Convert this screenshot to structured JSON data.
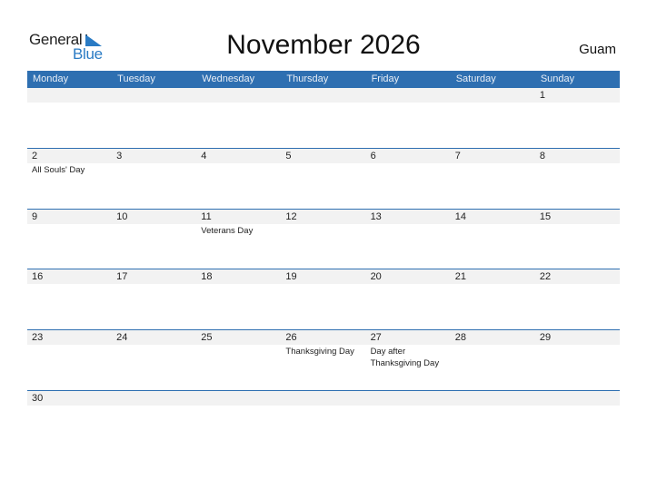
{
  "logo": {
    "general": "General",
    "blue": "Blue"
  },
  "title": "November 2026",
  "region": "Guam",
  "weekdays": [
    "Monday",
    "Tuesday",
    "Wednesday",
    "Thursday",
    "Friday",
    "Saturday",
    "Sunday"
  ],
  "weeks": [
    [
      {
        "d": ""
      },
      {
        "d": ""
      },
      {
        "d": ""
      },
      {
        "d": ""
      },
      {
        "d": ""
      },
      {
        "d": ""
      },
      {
        "d": "1"
      }
    ],
    [
      {
        "d": "2",
        "h": "All Souls' Day"
      },
      {
        "d": "3"
      },
      {
        "d": "4"
      },
      {
        "d": "5"
      },
      {
        "d": "6"
      },
      {
        "d": "7"
      },
      {
        "d": "8"
      }
    ],
    [
      {
        "d": "9"
      },
      {
        "d": "10"
      },
      {
        "d": "11",
        "h": "Veterans Day"
      },
      {
        "d": "12"
      },
      {
        "d": "13"
      },
      {
        "d": "14"
      },
      {
        "d": "15"
      }
    ],
    [
      {
        "d": "16"
      },
      {
        "d": "17"
      },
      {
        "d": "18"
      },
      {
        "d": "19"
      },
      {
        "d": "20"
      },
      {
        "d": "21"
      },
      {
        "d": "22"
      }
    ],
    [
      {
        "d": "23"
      },
      {
        "d": "24"
      },
      {
        "d": "25"
      },
      {
        "d": "26",
        "h": "Thanksgiving Day"
      },
      {
        "d": "27",
        "h": "Day after Thanksgiving Day"
      },
      {
        "d": "28"
      },
      {
        "d": "29"
      }
    ],
    [
      {
        "d": "30"
      },
      {
        "d": ""
      },
      {
        "d": ""
      },
      {
        "d": ""
      },
      {
        "d": ""
      },
      {
        "d": ""
      },
      {
        "d": ""
      }
    ]
  ],
  "colors": {
    "header": "#2e6fb1",
    "brand_blue": "#2a7bc4",
    "day_bar": "#f2f2f2"
  }
}
